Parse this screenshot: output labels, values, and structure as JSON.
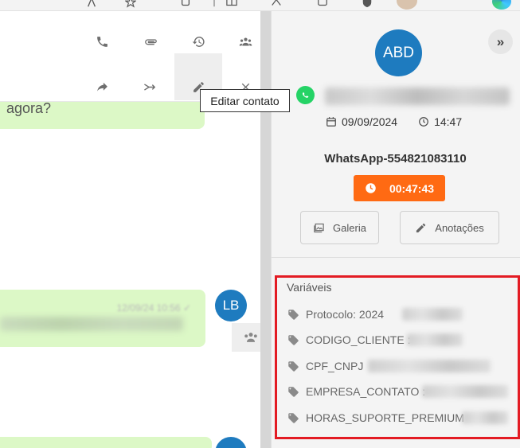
{
  "tooltip": {
    "text": "Editar contato"
  },
  "chat": {
    "message_1_text": "agora?",
    "message_2_time": "12/09/24 10:56 ✓",
    "agent_avatar_initials": "LB"
  },
  "contact": {
    "avatar_initials": "ABD",
    "date": "09/09/2024",
    "time": "14:47",
    "whatsapp_id": "WhatsApp-554821083110",
    "timer": "00:47:43"
  },
  "buttons": {
    "galeria": "Galeria",
    "anotacoes": "Anotações"
  },
  "variables": {
    "title": "Variáveis",
    "items": [
      "Protocolo: 2024",
      "CODIGO_CLIENTE :",
      "CPF_CNPJ",
      "EMPRESA_CONTATO :",
      "HORAS_SUPORTE_PREMIUM"
    ]
  },
  "colors": {
    "accent_blue": "#1e7bbf",
    "timer_orange": "#ff6a13",
    "highlight_red": "#e31b23",
    "bubble_green": "#dcf8c6",
    "whatsapp_green": "#25d366"
  }
}
